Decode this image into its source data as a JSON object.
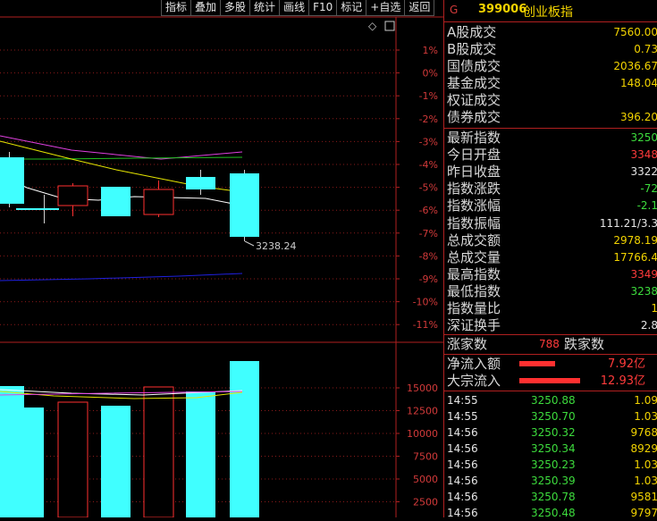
{
  "toolbar": {
    "buttons": [
      "指标",
      "叠加",
      "多股",
      "统计",
      "画线",
      "F10",
      "标记",
      "+自选",
      "返回"
    ]
  },
  "chart": {
    "pct_ticks": [
      "1%",
      "0%",
      "-1%",
      "-2%",
      "-3%",
      "-4%",
      "-5%",
      "-6%",
      "-7%",
      "-8%",
      "-9%",
      "-10%",
      "-11%"
    ],
    "low_label": "3238.24",
    "vol_ticks": [
      "15000",
      "12500",
      "10000",
      "7500",
      "5000",
      "2500"
    ],
    "diamond": "◇",
    "colors": {
      "up": "#ff3030",
      "down": "#40ffff",
      "grid": "#8a1a1a",
      "ma5": "#ffffff",
      "ma10": "#e6e600",
      "ma20": "#e040e0",
      "ma30": "#20c020",
      "ma60": "#2020e0"
    }
  },
  "panel": {
    "header": {
      "prefix": "G",
      "code": "399006",
      "name": "创业板指"
    },
    "turnover": [
      {
        "label": "A股成交",
        "value": "7560.00"
      },
      {
        "label": "B股成交",
        "value": "0.73"
      },
      {
        "label": "国债成交",
        "value": "2036.67"
      },
      {
        "label": "基金成交",
        "value": "148.04"
      },
      {
        "label": "权证成交",
        "value": ""
      },
      {
        "label": "债券成交",
        "value": "396.20"
      }
    ],
    "stats": [
      {
        "label": "最新指数",
        "value": "3250",
        "color": "grn"
      },
      {
        "label": "今日开盘",
        "value": "3348",
        "color": "red"
      },
      {
        "label": "昨日收盘",
        "value": "3322",
        "color": "wht"
      },
      {
        "label": "指数涨跌",
        "value": "-72",
        "color": "grn"
      },
      {
        "label": "指数涨幅",
        "value": "-2.1",
        "color": "grn"
      },
      {
        "label": "指数振幅",
        "value": "111.21/3.3",
        "color": "wht"
      },
      {
        "label": "总成交额",
        "value": "2978.19",
        "color": "yel"
      },
      {
        "label": "总成交量",
        "value": "17766.4",
        "color": "yel"
      },
      {
        "label": "最高指数",
        "value": "3349",
        "color": "red"
      },
      {
        "label": "最低指数",
        "value": "3238",
        "color": "grn"
      },
      {
        "label": "指数量比",
        "value": "1",
        "color": "yel"
      },
      {
        "label": "深证换手",
        "value": "2.8",
        "color": "wht"
      }
    ],
    "breadth": {
      "up_label": "涨家数",
      "up_count": "788",
      "down_label": "跌家数"
    },
    "flows": [
      {
        "label": "净流入额",
        "value": "7.92亿"
      },
      {
        "label": "大宗流入",
        "value": "12.93亿"
      }
    ],
    "ticks": [
      {
        "time": "14:55",
        "price": "3250.88",
        "vol": "1.09"
      },
      {
        "time": "14:55",
        "price": "3250.70",
        "vol": "1.03"
      },
      {
        "time": "14:56",
        "price": "3250.32",
        "vol": "9768"
      },
      {
        "time": "14:56",
        "price": "3250.34",
        "vol": "8929"
      },
      {
        "time": "14:56",
        "price": "3250.23",
        "vol": "1.03"
      },
      {
        "time": "14:56",
        "price": "3250.39",
        "vol": "1.03"
      },
      {
        "time": "14:56",
        "price": "3250.78",
        "vol": "9581"
      },
      {
        "time": "14:56",
        "price": "3250.48",
        "vol": "9797"
      }
    ]
  }
}
